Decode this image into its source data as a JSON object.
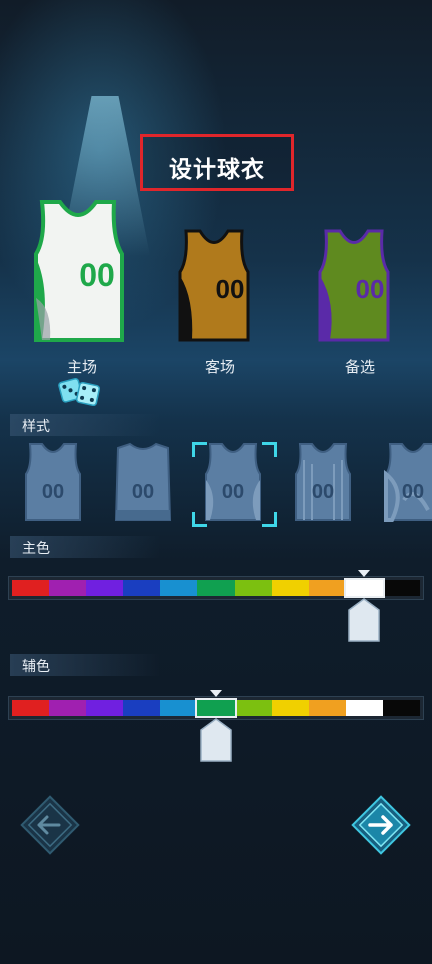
{
  "title": "设计球衣",
  "jerseys": [
    {
      "label": "主场",
      "number": "00",
      "body": "#f2f4f2",
      "trim": "#1fa84a",
      "numColor": "#1fa84a"
    },
    {
      "label": "客场",
      "number": "00",
      "body": "#b07a1c",
      "trim": "#111111",
      "numColor": "#111111"
    },
    {
      "label": "备选",
      "number": "00",
      "body": "#5f8a1f",
      "trim": "#5a2aa8",
      "numColor": "#5a2aa8"
    }
  ],
  "sections": {
    "style": "样式",
    "primary": "主色",
    "secondary": "辅色"
  },
  "style_number": "00",
  "palette": [
    "#e02020",
    "#a020b0",
    "#7020e0",
    "#1a3ec0",
    "#1890d0",
    "#10a050",
    "#7cc010",
    "#f0d000",
    "#f0a020",
    "#ffffff",
    "#080808"
  ],
  "primary_selected_index": 9,
  "secondary_selected_index": 5,
  "selected_style_index": 2
}
